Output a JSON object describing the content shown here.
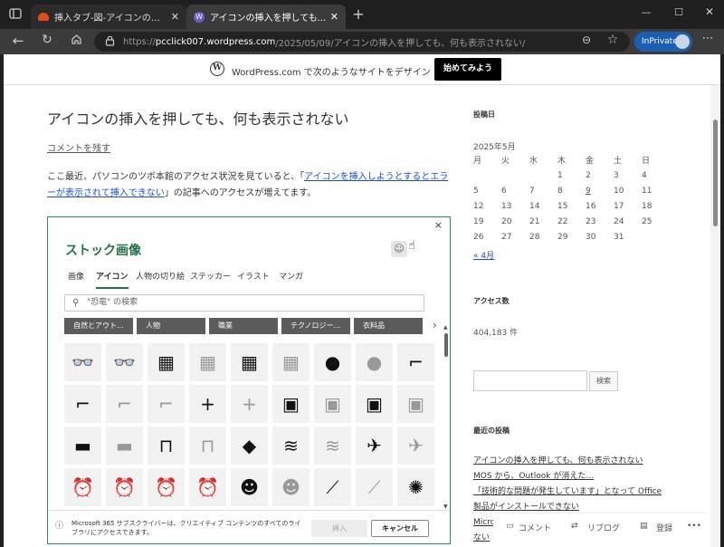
{
  "browser": {
    "tabs": [
      {
        "title": "挿入タブ-図-アイコンのダイアログが白"
      },
      {
        "title": "アイコンの挿入を押しても、何も表示さ"
      }
    ],
    "url_prefix": "https://",
    "url_host": "pcclick007.wordpress.com",
    "url_path": "/2025/05/09/アイコンの挿入を押しても、何も表示されない/",
    "inprivate": "InPrivate"
  },
  "wpbar": {
    "text": "WordPress.com で次のようなサイトをデザイン",
    "cta": "始めてみよう"
  },
  "post": {
    "title": "アイコンの挿入を押しても、何も表示されない",
    "comment_link": "コメントを残す",
    "para_before": "ここ最近、パソコンのツボ本館のアクセス状況を見ていると、「",
    "para_link": "アイコンを挿入しようとするとエラーが表示されて挿入できない",
    "para_after": "」の記事へのアクセスが増えてます。"
  },
  "dialog": {
    "close": "×",
    "title": "ストック画像",
    "tabs": [
      "画像",
      "アイコン",
      "人物の切り絵",
      "ステッカー",
      "イラスト",
      "マンガ"
    ],
    "selected_tab": "アイコン",
    "search_placeholder": "\"恐竜\" の検索",
    "categories": [
      "自然とアウト…",
      "人物",
      "職業",
      "テクノロジー…",
      "衣料品"
    ],
    "icon_rows": [
      [
        "glasses-3d-icon",
        "glasses-3d-outline-icon",
        "abacus-icon",
        "abacus-outline-icon",
        "abacus-icon",
        "abacus-outline-icon",
        "acorn-icon",
        "acorn-outline-icon",
        "pipe-icon"
      ],
      [
        "pipe-icon",
        "pipe-outline-icon",
        "pipe-outline-icon",
        "plus-icon",
        "plus-outline-icon",
        "address-book-icon",
        "address-book-outline-icon",
        "address-book-icon",
        "address-book-outline-icon"
      ],
      [
        "bandage-icon",
        "bandage-outline-icon",
        "billboard-icon",
        "billboard-outline-icon",
        "africa-icon",
        "farm-field-icon",
        "farm-field-outline-icon",
        "airplane-icon",
        "airplane-outline-icon"
      ],
      [
        "alarm-clock-icon",
        "alarm-clock-outline-icon",
        "alarm-ringing-icon",
        "alarm-ringing-outline-icon",
        "alien-icon",
        "alien-outline-icon",
        "sewing-needle-icon",
        "sewing-needle-outline-icon",
        "yarn-ball-icon"
      ]
    ],
    "footer_info": "Microsoft 365 サブスクライバーは、クリエイティブ コンテンツのすべてのライブラリにアクセスできます。",
    "insert": "挿入",
    "cancel": "キャンセル"
  },
  "sidebar": {
    "archive_heading": "投稿日",
    "calendar_caption": "2025年5月",
    "weekdays": [
      "月",
      "火",
      "水",
      "木",
      "金",
      "土",
      "日"
    ],
    "weeks": [
      [
        "",
        "",
        "",
        "1",
        "2",
        "3",
        "4"
      ],
      [
        "5",
        "6",
        "7",
        "8",
        "9",
        "10",
        "11"
      ],
      [
        "12",
        "13",
        "14",
        "15",
        "16",
        "17",
        "18"
      ],
      [
        "19",
        "20",
        "21",
        "22",
        "23",
        "24",
        "25"
      ],
      [
        "26",
        "27",
        "28",
        "29",
        "30",
        "31",
        ""
      ]
    ],
    "linked_day": "9",
    "prev_month": "« 4月",
    "access_heading": "アクセス数",
    "access_count": "404,183 件",
    "search_button": "検索",
    "recent_heading": "最近の投稿",
    "recent_posts": [
      "アイコンの挿入を押しても、何も表示されない",
      "MOS から、Outlook が消えた…",
      "「技術的な問題が発生しています」となって Office",
      "製品がインストールできない",
      "Micro"
    ],
    "recent_tail": "ない"
  },
  "bottom_bar": {
    "comment": "コメント",
    "reblog": "リブログ",
    "subscribe": "登録",
    "more": "•••"
  }
}
